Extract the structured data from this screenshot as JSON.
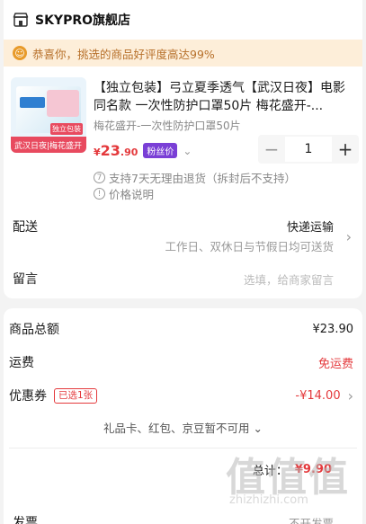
{
  "store": {
    "name": "SKYPRO旗舰店",
    "icon": "store-icon"
  },
  "notice": {
    "text": "恭喜你，挑选的商品好评度高达99%",
    "icon": "smile-icon"
  },
  "product": {
    "image_strip_text": "武汉日夜|梅花盛开",
    "image_badge_text": "独立包装",
    "title": "【独立包装】弓立夏季透气【武汉日夜】电影同名款 一次性防护口罩50片 梅花盛开-...",
    "sku": "梅花盛开-一次性防护口罩50片",
    "price": {
      "currency": "¥",
      "integer": "23",
      "decimal": ".90"
    },
    "fan_badge": "粉丝价",
    "quantity": "1",
    "minus_label": "−",
    "plus_label": "+",
    "services": [
      {
        "icon": "return-7-icon",
        "icon_text": "7",
        "text": "支持7天无理由退货（拆封后不支持）"
      },
      {
        "icon": "info-icon",
        "icon_text": "!",
        "text": "价格说明"
      }
    ]
  },
  "shipping": {
    "label": "配送",
    "method": "快递运输",
    "note": "工作日、双休日与节假日均可送货"
  },
  "message": {
    "label": "留言",
    "placeholder": "选填，给商家留言"
  },
  "summary": {
    "total_label": "商品总额",
    "total_value": "¥23.90",
    "shipping_label": "运费",
    "shipping_value": "免运费",
    "coupon_label": "优惠券",
    "coupon_tag": "已选1张",
    "coupon_value": "-¥14.00",
    "gift_text": "礼品卡、红包、京豆暂不可用 ⌄",
    "grand_label": "总计：",
    "grand_value": "¥9.90"
  },
  "invoice": {
    "label": "发票",
    "value": "不开发票"
  },
  "watermark": {
    "big": "值值值",
    "small": "zhizhizhi.com"
  },
  "colors": {
    "accent_red": "#e4393c",
    "notice_bg": "#fdeed9",
    "notice_text": "#b7702a",
    "fan_badge": "#7a3fd6"
  }
}
